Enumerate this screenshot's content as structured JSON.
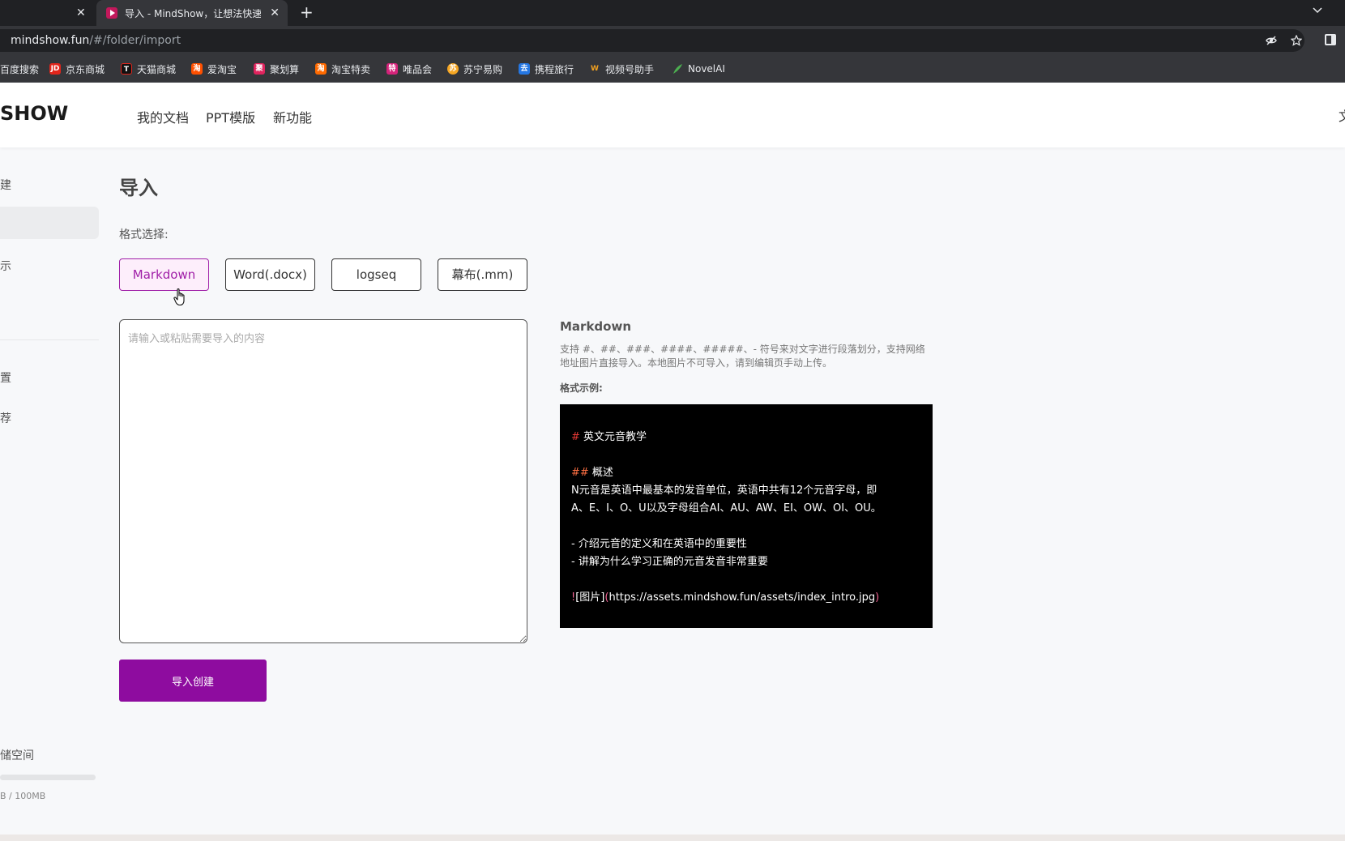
{
  "browser": {
    "active_tab_title": "导入 - MindShow，让想法快速",
    "address_host": "mindshow.fun",
    "address_path": "/#/folder/import",
    "bookmarks": [
      {
        "label": "百度搜索",
        "icon": "baidu-icon",
        "color": "#35363a",
        "glyph": ""
      },
      {
        "label": "京东商城",
        "icon": "jd-icon",
        "color": "#e1251b",
        "glyph": "JD"
      },
      {
        "label": "天猫商城",
        "icon": "tmall-icon",
        "color": "#111111",
        "glyph": "T"
      },
      {
        "label": "爱淘宝",
        "icon": "aitaobao-icon",
        "color": "#ff5000",
        "glyph": "淘"
      },
      {
        "label": "聚划算",
        "icon": "juhuasuan-icon",
        "color": "#e0245e",
        "glyph": "聚"
      },
      {
        "label": "淘宝特卖",
        "icon": "taobao-sale-icon",
        "color": "#ff6a00",
        "glyph": "淘"
      },
      {
        "label": "唯品会",
        "icon": "vip-icon",
        "color": "#d4237a",
        "glyph": "特"
      },
      {
        "label": "苏宁易购",
        "icon": "suning-icon",
        "color": "#f5a623",
        "glyph": "苏"
      },
      {
        "label": "携程旅行",
        "icon": "ctrip-icon",
        "color": "#2577e3",
        "glyph": "去"
      },
      {
        "label": "视频号助手",
        "icon": "channels-icon",
        "color": "#f0a020",
        "glyph": "W"
      },
      {
        "label": "NovelAI",
        "icon": "novelai-icon",
        "color": "#4caf50",
        "glyph": ""
      }
    ]
  },
  "header": {
    "logo": "SHOW",
    "nav": [
      "我的文档",
      "PPT模版",
      "新功能"
    ],
    "right_text": "文"
  },
  "sidebar": {
    "items": [
      "建",
      "示",
      "置",
      "荐"
    ],
    "storage_label": "储空间",
    "storage_usage": "B / 100MB",
    "storage_fraction": 0.0
  },
  "main": {
    "title": "导入",
    "format_label": "格式选择:",
    "formats": [
      "Markdown",
      "Word(.docx)",
      "logseq",
      "幕布(.mm)"
    ],
    "selected_format": "Markdown",
    "input_placeholder": "请输入或粘贴需要导入的内容",
    "import_button": "导入创建"
  },
  "info": {
    "title": "Markdown",
    "description": "支持 #、##、###、####、#####、- 符号来对文字进行段落划分，支持网络地址图片直接导入。本地图片不可导入，请到编辑页手动上传。",
    "example_label": "格式示例:",
    "example": {
      "h1_marker": "#",
      "h1_text": " 英文元音教学",
      "h2_marker": "##",
      "h2_text": " 概述",
      "para_line1": " N元音是英语中最基本的发音单位，英语中共有12个元音字母，即",
      "para_line2": "A、E、I、O、U以及字母组合AI、AU、AW、EI、OW、OI、OU。",
      "bullet1": "- 介绍元音的定义和在英语中的重要性",
      "bullet2": "- 讲解为什么学习正确的元音发音非常重要",
      "img_open": "!",
      "img_alt": "[图片]",
      "img_paren_open": "(",
      "img_url": "https://assets.mindshow.fun/assets/index_intro.jpg",
      "img_paren_close": ")"
    }
  },
  "colors": {
    "accent": "#8e0c9f",
    "active_chip_bg": "#fdeefb"
  }
}
